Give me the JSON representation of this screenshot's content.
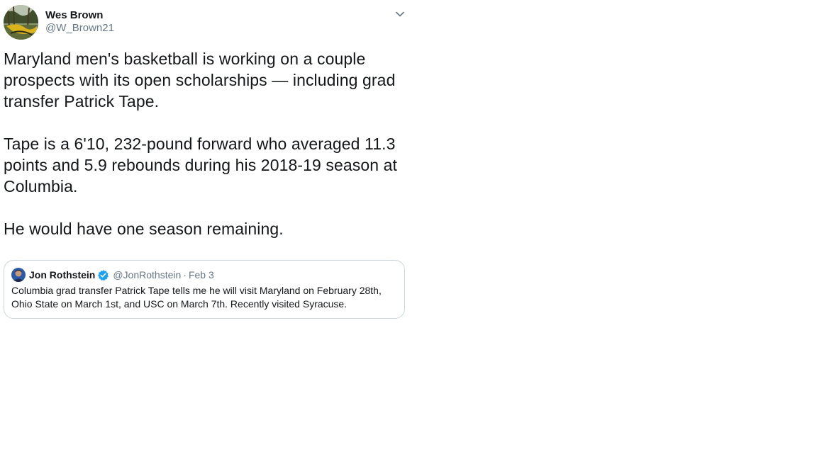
{
  "tweet": {
    "author": {
      "display_name": "Wes Brown",
      "handle": "@W_Brown21"
    },
    "menu_icon": "chevron-down-icon",
    "text": "Maryland men's basketball is working on a couple prospects with its open scholarships — including grad transfer Patrick Tape.\n\nTape is a 6'10, 232-pound forward who averaged 11.3 points and 5.9 rebounds during his 2018-19 season at Columbia.\n\nHe would have one season remaining."
  },
  "quoted_tweet": {
    "author": {
      "display_name": "Jon Rothstein",
      "verified_icon": "verified-badge-icon",
      "handle": "@JonRothstein",
      "separator": "·",
      "date": "Feb 3"
    },
    "text": "Columbia grad transfer Patrick Tape tells me he will visit Maryland on February 28th, Ohio State on March 1st, and USC on March 7th. Recently visited Syracuse."
  },
  "colors": {
    "text_primary": "#14171a",
    "text_secondary": "#657786",
    "border": "#ccd6dd",
    "verified_blue": "#1da1f2"
  }
}
